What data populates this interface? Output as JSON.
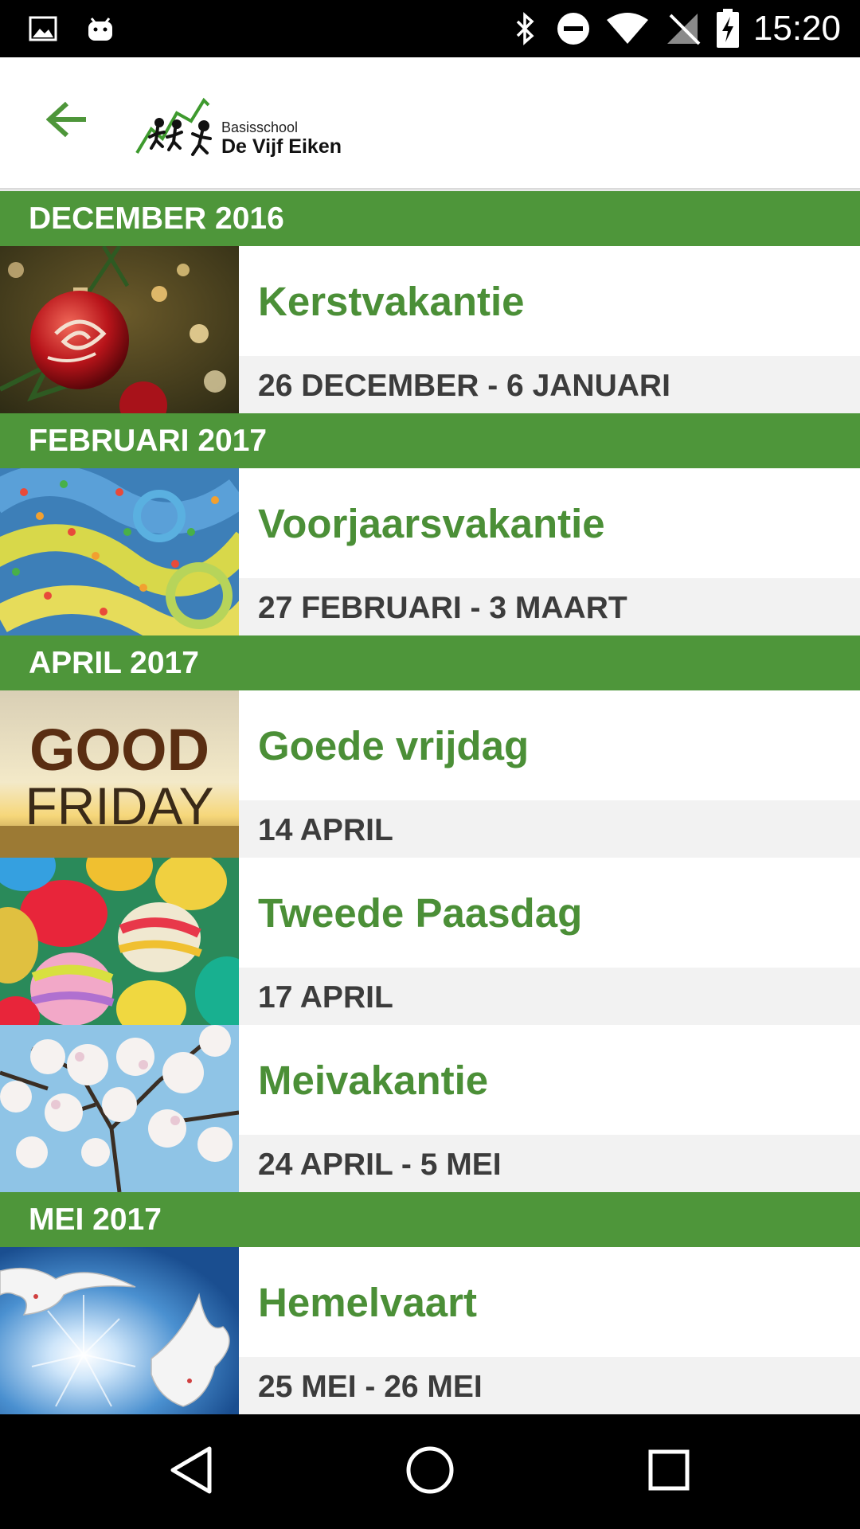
{
  "status_bar": {
    "time": "15:20",
    "icons": [
      "image-icon",
      "android-icon",
      "bluetooth-icon",
      "do-not-disturb-icon",
      "wifi-icon",
      "no-signal-icon",
      "battery-charging-icon"
    ]
  },
  "toolbar": {
    "back_icon": "arrow-back-icon",
    "logo_line1": "Basisschool",
    "logo_line2": "De Vijf Eiken"
  },
  "colors": {
    "accent": "#4e963a",
    "title_green": "#4b8f37",
    "date_text": "#3c3c3c",
    "date_bg": "#f2f2f2"
  },
  "sections": [
    {
      "month": "DECEMBER 2016",
      "events": [
        {
          "title": "Kerstvakantie",
          "date": "26 DECEMBER - 6 JANUARI",
          "image": "christmas-bauble-image"
        }
      ]
    },
    {
      "month": "FEBRUARI 2017",
      "events": [
        {
          "title": "Voorjaarsvakantie",
          "date": "27 FEBRUARI - 3 MAART",
          "image": "carnival-streamers-image"
        }
      ]
    },
    {
      "month": "APRIL 2017",
      "events": [
        {
          "title": "Goede vrijdag",
          "date": "14 APRIL",
          "image": "good-friday-image",
          "image_text_1": "GOOD",
          "image_text_2": "FRIDAY"
        },
        {
          "title": "Tweede Paasdag",
          "date": "17 APRIL",
          "image": "easter-eggs-image"
        },
        {
          "title": "Meivakantie",
          "date": "24 APRIL - 5 MEI",
          "image": "blossom-tree-image"
        }
      ]
    },
    {
      "month": "MEI 2017",
      "events": [
        {
          "title": "Hemelvaart",
          "date": "25 MEI - 26 MEI",
          "image": "doves-sky-image"
        }
      ]
    }
  ],
  "nav_bar": {
    "icons": [
      "back-triangle-icon",
      "home-circle-icon",
      "recents-square-icon"
    ]
  }
}
